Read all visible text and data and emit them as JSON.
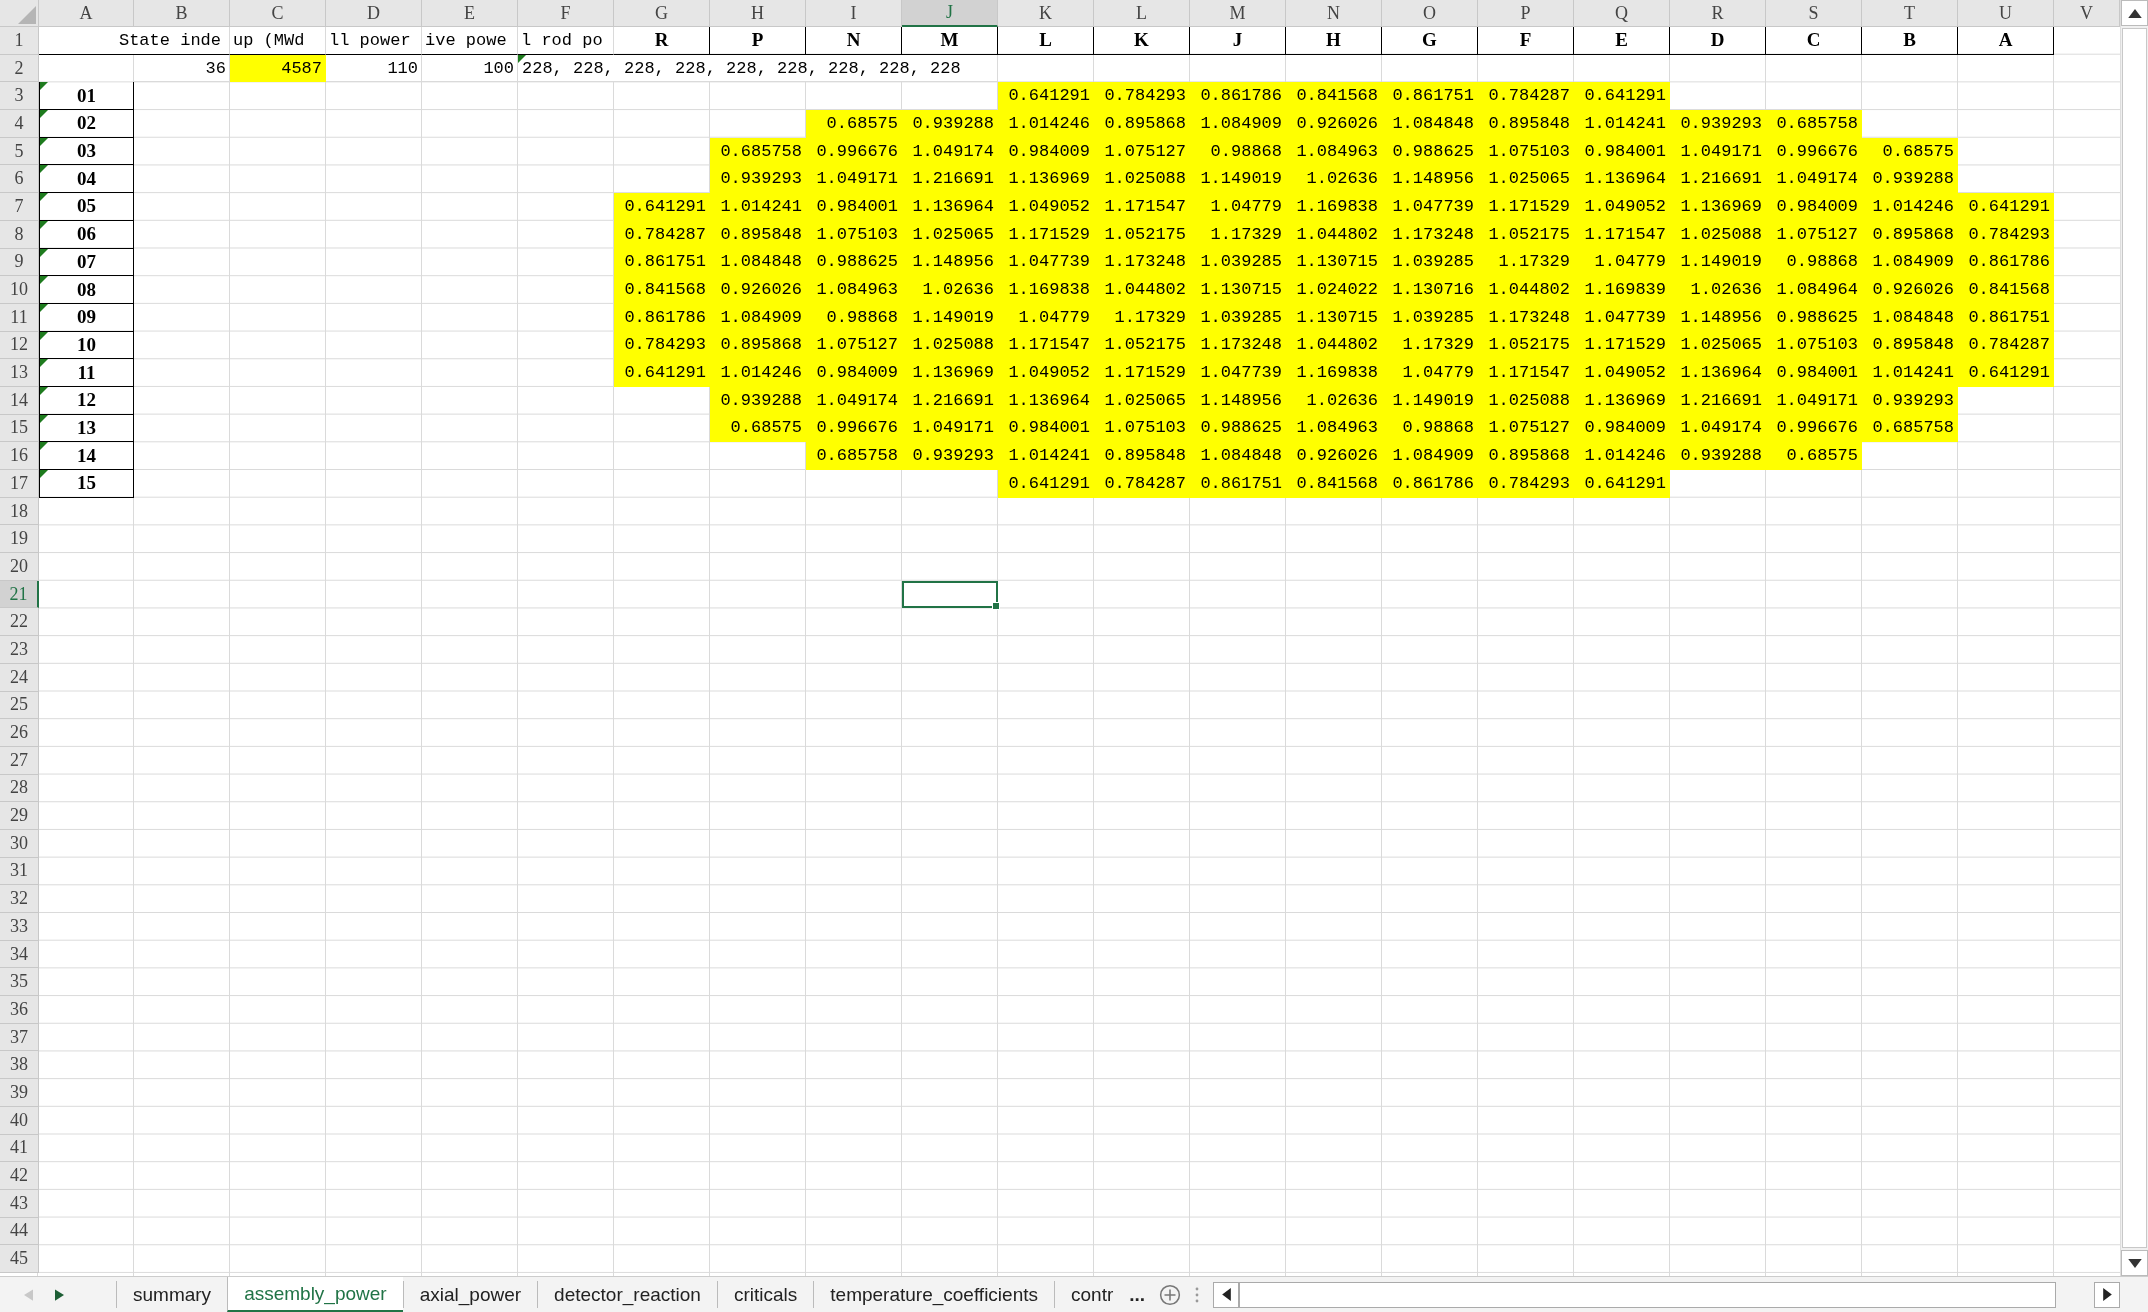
{
  "column_headers": [
    {
      "label": "A",
      "selected": false
    },
    {
      "label": "B",
      "selected": false
    },
    {
      "label": "C",
      "selected": false
    },
    {
      "label": "D",
      "selected": false
    },
    {
      "label": "E",
      "selected": false
    },
    {
      "label": "F",
      "selected": false
    },
    {
      "label": "G",
      "selected": false
    },
    {
      "label": "H",
      "selected": false
    },
    {
      "label": "I",
      "selected": false
    },
    {
      "label": "J",
      "selected": true
    },
    {
      "label": "K",
      "selected": false
    },
    {
      "label": "L",
      "selected": false
    },
    {
      "label": "M",
      "selected": false
    },
    {
      "label": "N",
      "selected": false
    },
    {
      "label": "O",
      "selected": false
    },
    {
      "label": "P",
      "selected": false
    },
    {
      "label": "Q",
      "selected": false
    },
    {
      "label": "R",
      "selected": false
    },
    {
      "label": "S",
      "selected": false
    },
    {
      "label": "T",
      "selected": false
    },
    {
      "label": "U",
      "selected": false
    },
    {
      "label": "V",
      "selected": false
    }
  ],
  "row_headers": [
    {
      "label": "1",
      "selected": false
    },
    {
      "label": "2",
      "selected": false
    },
    {
      "label": "3",
      "selected": false
    },
    {
      "label": "4",
      "selected": false
    },
    {
      "label": "5",
      "selected": false
    },
    {
      "label": "6",
      "selected": false
    },
    {
      "label": "7",
      "selected": false
    },
    {
      "label": "8",
      "selected": false
    },
    {
      "label": "9",
      "selected": false
    },
    {
      "label": "10",
      "selected": false
    },
    {
      "label": "11",
      "selected": false
    },
    {
      "label": "12",
      "selected": false
    },
    {
      "label": "13",
      "selected": false
    },
    {
      "label": "14",
      "selected": false
    },
    {
      "label": "15",
      "selected": false
    },
    {
      "label": "16",
      "selected": false
    },
    {
      "label": "17",
      "selected": false
    },
    {
      "label": "18",
      "selected": false
    },
    {
      "label": "19",
      "selected": false
    },
    {
      "label": "20",
      "selected": false
    },
    {
      "label": "21",
      "selected": true
    },
    {
      "label": "22",
      "selected": false
    },
    {
      "label": "23",
      "selected": false
    },
    {
      "label": "24",
      "selected": false
    },
    {
      "label": "25",
      "selected": false
    },
    {
      "label": "26",
      "selected": false
    },
    {
      "label": "27",
      "selected": false
    },
    {
      "label": "28",
      "selected": false
    },
    {
      "label": "29",
      "selected": false
    },
    {
      "label": "30",
      "selected": false
    },
    {
      "label": "31",
      "selected": false
    },
    {
      "label": "32",
      "selected": false
    },
    {
      "label": "33",
      "selected": false
    },
    {
      "label": "34",
      "selected": false
    },
    {
      "label": "35",
      "selected": false
    },
    {
      "label": "36",
      "selected": false
    },
    {
      "label": "37",
      "selected": false
    },
    {
      "label": "38",
      "selected": false
    },
    {
      "label": "39",
      "selected": false
    },
    {
      "label": "40",
      "selected": false
    },
    {
      "label": "41",
      "selected": false
    },
    {
      "label": "42",
      "selected": false
    },
    {
      "label": "43",
      "selected": false
    },
    {
      "label": "44",
      "selected": false
    },
    {
      "label": "45",
      "selected": false
    }
  ],
  "row_1": {
    "state_index": "State inde",
    "column_c": "up (MWd",
    "column_d": "ll power",
    "column_e": "ive powe",
    "column_f": "l rod po",
    "assembly_columns": [
      "R",
      "P",
      "N",
      "M",
      "L",
      "K",
      "J",
      "H",
      "G",
      "F",
      "E",
      "D",
      "C",
      "B",
      "A"
    ]
  },
  "row_2": {
    "values": [
      {
        "text": "36",
        "highlighted": false
      },
      {
        "text": "4587",
        "highlighted": true
      },
      {
        "text": "110",
        "highlighted": false
      },
      {
        "text": "100",
        "highlighted": false
      }
    ],
    "rod_positions": {
      "text": "228, 228, 228, 228, 228, 228, 228, 228, 228",
      "flagged": true
    }
  },
  "assembly_rows": [
    {
      "label": "01",
      "flagged": true,
      "cells": [
        null,
        null,
        null,
        null,
        "0.641291",
        "0.784293",
        "0.861786",
        "0.841568",
        "0.861751",
        "0.784287",
        "0.641291",
        null,
        null,
        null,
        null
      ]
    },
    {
      "label": "02",
      "flagged": true,
      "cells": [
        null,
        null,
        "0.68575",
        "0.939288",
        "1.014246",
        "0.895868",
        "1.084909",
        "0.926026",
        "1.084848",
        "0.895848",
        "1.014241",
        "0.939293",
        "0.685758",
        null,
        null
      ]
    },
    {
      "label": "03",
      "flagged": true,
      "cells": [
        null,
        "0.685758",
        "0.996676",
        "1.049174",
        "0.984009",
        "1.075127",
        "0.98868",
        "1.084963",
        "0.988625",
        "1.075103",
        "0.984001",
        "1.049171",
        "0.996676",
        "0.68575",
        null
      ]
    },
    {
      "label": "04",
      "flagged": true,
      "cells": [
        null,
        "0.939293",
        "1.049171",
        "1.216691",
        "1.136969",
        "1.025088",
        "1.149019",
        "1.02636",
        "1.148956",
        "1.025065",
        "1.136964",
        "1.216691",
        "1.049174",
        "0.939288",
        null
      ]
    },
    {
      "label": "05",
      "flagged": true,
      "cells": [
        "0.641291",
        "1.014241",
        "0.984001",
        "1.136964",
        "1.049052",
        "1.171547",
        "1.04779",
        "1.169838",
        "1.047739",
        "1.171529",
        "1.049052",
        "1.136969",
        "0.984009",
        "1.014246",
        "0.641291"
      ]
    },
    {
      "label": "06",
      "flagged": true,
      "cells": [
        "0.784287",
        "0.895848",
        "1.075103",
        "1.025065",
        "1.171529",
        "1.052175",
        "1.17329",
        "1.044802",
        "1.173248",
        "1.052175",
        "1.171547",
        "1.025088",
        "1.075127",
        "0.895868",
        "0.784293"
      ]
    },
    {
      "label": "07",
      "flagged": true,
      "cells": [
        "0.861751",
        "1.084848",
        "0.988625",
        "1.148956",
        "1.047739",
        "1.173248",
        "1.039285",
        "1.130715",
        "1.039285",
        "1.17329",
        "1.04779",
        "1.149019",
        "0.98868",
        "1.084909",
        "0.861786"
      ]
    },
    {
      "label": "08",
      "flagged": true,
      "cells": [
        "0.841568",
        "0.926026",
        "1.084963",
        "1.02636",
        "1.169838",
        "1.044802",
        "1.130715",
        "1.024022",
        "1.130716",
        "1.044802",
        "1.169839",
        "1.02636",
        "1.084964",
        "0.926026",
        "0.841568"
      ]
    },
    {
      "label": "09",
      "flagged": true,
      "cells": [
        "0.861786",
        "1.084909",
        "0.98868",
        "1.149019",
        "1.04779",
        "1.17329",
        "1.039285",
        "1.130715",
        "1.039285",
        "1.173248",
        "1.047739",
        "1.148956",
        "0.988625",
        "1.084848",
        "0.861751"
      ]
    },
    {
      "label": "10",
      "flagged": true,
      "cells": [
        "0.784293",
        "0.895868",
        "1.075127",
        "1.025088",
        "1.171547",
        "1.052175",
        "1.173248",
        "1.044802",
        "1.17329",
        "1.052175",
        "1.171529",
        "1.025065",
        "1.075103",
        "0.895848",
        "0.784287"
      ]
    },
    {
      "label": "11",
      "flagged": true,
      "cells": [
        "0.641291",
        "1.014246",
        "0.984009",
        "1.136969",
        "1.049052",
        "1.171529",
        "1.047739",
        "1.169838",
        "1.04779",
        "1.171547",
        "1.049052",
        "1.136964",
        "0.984001",
        "1.014241",
        "0.641291"
      ]
    },
    {
      "label": "12",
      "flagged": true,
      "cells": [
        null,
        "0.939288",
        "1.049174",
        "1.216691",
        "1.136964",
        "1.025065",
        "1.148956",
        "1.02636",
        "1.149019",
        "1.025088",
        "1.136969",
        "1.216691",
        "1.049171",
        "0.939293",
        null
      ]
    },
    {
      "label": "13",
      "flagged": true,
      "cells": [
        null,
        "0.68575",
        "0.996676",
        "1.049171",
        "0.984001",
        "1.075103",
        "0.988625",
        "1.084963",
        "0.98868",
        "1.075127",
        "0.984009",
        "1.049174",
        "0.996676",
        "0.685758",
        null
      ]
    },
    {
      "label": "14",
      "flagged": true,
      "cells": [
        null,
        null,
        "0.685758",
        "0.939293",
        "1.014241",
        "0.895848",
        "1.084848",
        "0.926026",
        "1.084909",
        "0.895868",
        "1.014246",
        "0.939288",
        "0.68575",
        null,
        null
      ]
    },
    {
      "label": "15",
      "flagged": true,
      "cells": [
        null,
        null,
        null,
        null,
        "0.641291",
        "0.784287",
        "0.861751",
        "0.841568",
        "0.861786",
        "0.784293",
        "0.641291",
        null,
        null,
        null,
        null
      ]
    }
  ],
  "sheet_tabs": [
    {
      "label": "summary",
      "selected": false
    },
    {
      "label": "assembly_power",
      "selected": true
    },
    {
      "label": "axial_power",
      "selected": false
    },
    {
      "label": "detector_reaction",
      "selected": false
    },
    {
      "label": "criticals",
      "selected": false
    },
    {
      "label": "temperature_coefficients",
      "selected": false
    },
    {
      "label": "contr",
      "selected": false
    }
  ],
  "more_tabs": "..."
}
